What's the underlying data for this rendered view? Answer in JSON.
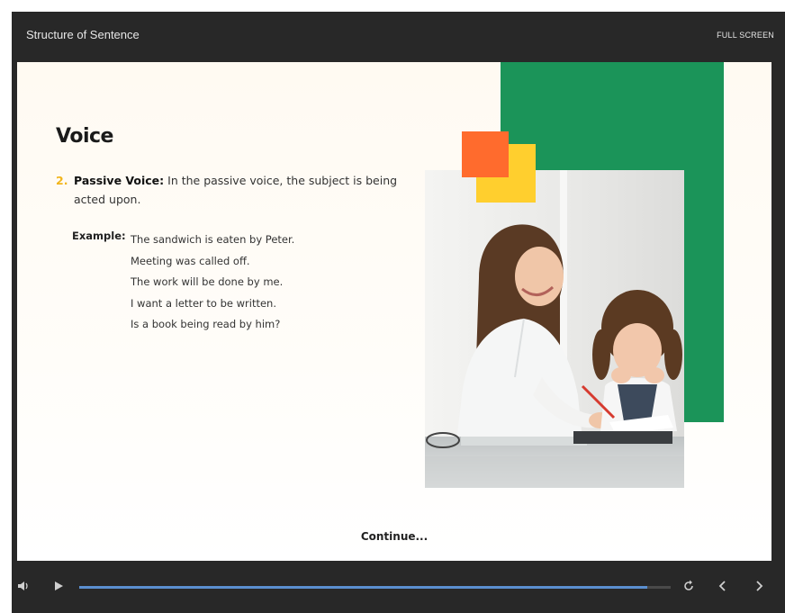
{
  "window": {
    "title": "Structure of Sentence",
    "fullscreen_label": "FULL SCREEN"
  },
  "slide": {
    "heading": "Voice",
    "point_number": "2.",
    "point_term": "Passive Voice:",
    "point_text": " In the passive voice, the subject is being acted upon.",
    "example_label": "Example:",
    "examples": [
      "The sandwich is eaten by Peter.",
      "Meeting was called off.",
      "The work will be done by me.",
      "I want a letter to be written.",
      "Is a book being read by him?"
    ],
    "continue_label": "Continue..."
  },
  "controls": {
    "progress": 0.96,
    "volume_icon": "volume-icon",
    "play_icon": "play-icon",
    "replay_icon": "replay-icon",
    "prev_icon": "chevron-left-icon",
    "next_icon": "chevron-right-icon"
  },
  "colors": {
    "accent_green": "#1b9459",
    "accent_orange": "#ff6b2d",
    "accent_yellow": "#ffcf2e",
    "progress_blue": "#5b8fd0"
  }
}
